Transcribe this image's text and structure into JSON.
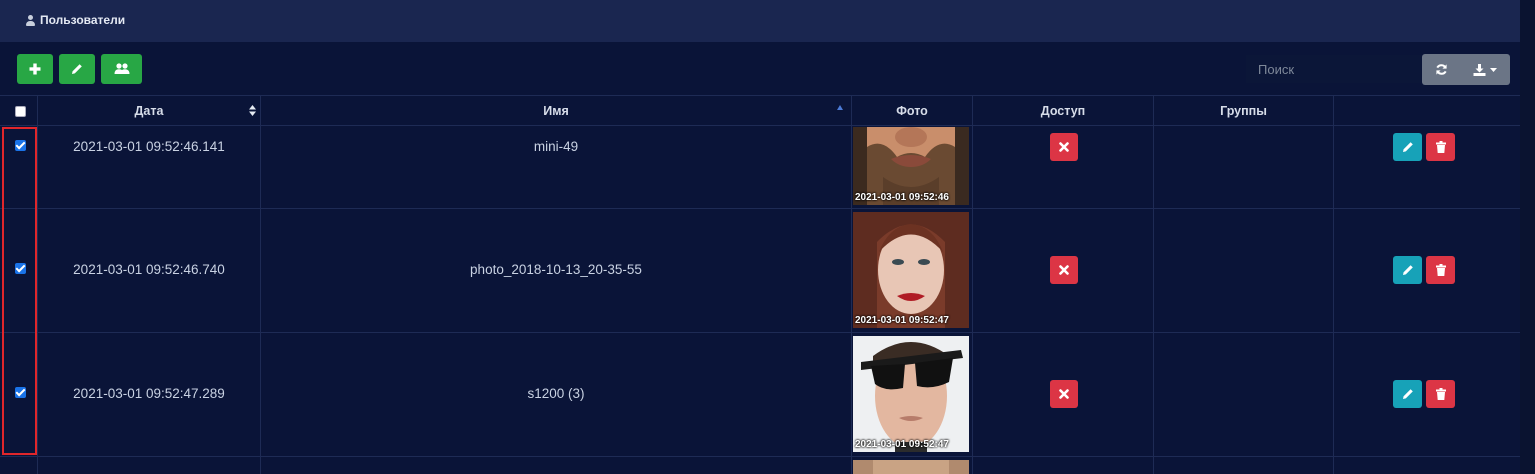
{
  "header": {
    "title": "Пользователи"
  },
  "toolbar": {
    "search_placeholder": "Поиск"
  },
  "table": {
    "columns": [
      "Дата",
      "Имя",
      "Фото",
      "Доступ",
      "Группы"
    ],
    "rows": [
      {
        "date": "2021-03-01 09:52:46.141",
        "name": "mini-49",
        "photo_stamp": "2021-03-01 09:52:46",
        "groups": ""
      },
      {
        "date": "2021-03-01 09:52:46.740",
        "name": "photo_2018-10-13_20-35-55",
        "photo_stamp": "2021-03-01 09:52:47",
        "groups": ""
      },
      {
        "date": "2021-03-01 09:52:47.289",
        "name": "s1200 (3)",
        "photo_stamp": "2021-03-01 09:52:47",
        "groups": ""
      }
    ]
  },
  "colors": {
    "background": "#0a1438",
    "header": "#1a2650",
    "green": "#28a745",
    "red": "#dc3545",
    "teal": "#17a2b8",
    "grey": "#6b7586"
  },
  "icons": [
    "user-icon",
    "plus-icon",
    "pencil-icon",
    "users-icon",
    "refresh-icon",
    "download-icon",
    "caret-down-icon",
    "times-icon",
    "trash-icon",
    "sort-icon",
    "sort-asc-icon"
  ]
}
